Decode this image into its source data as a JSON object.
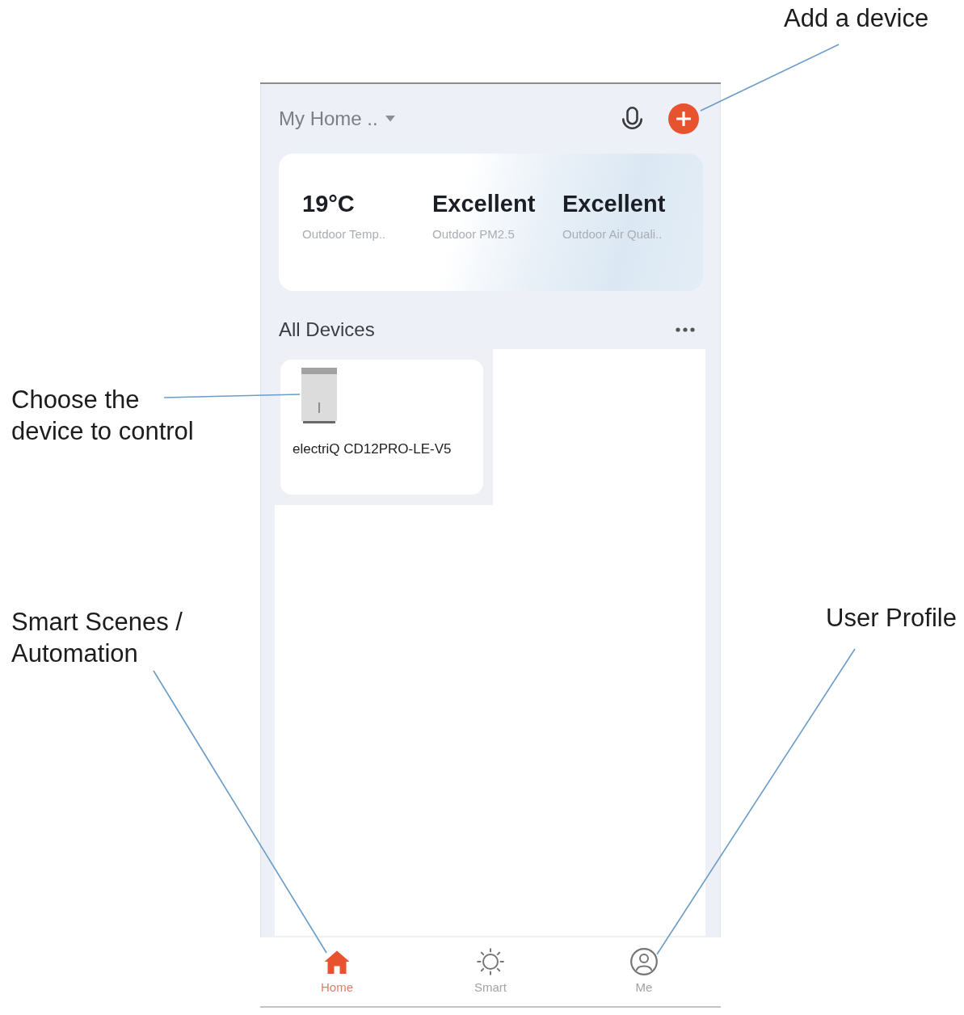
{
  "callouts": [
    {
      "text": "Add a device"
    },
    {
      "text": "Choose the device to control"
    },
    {
      "text": "Smart Scenes / Automation"
    },
    {
      "text": "User Profile"
    }
  ],
  "app": {
    "home_selector": {
      "label": "My Home .."
    },
    "weather": [
      {
        "value": "19°C",
        "label": "Outdoor Temp.."
      },
      {
        "value": "Excellent",
        "label": "Outdoor PM2.5"
      },
      {
        "value": "Excellent",
        "label": "Outdoor Air Quali.."
      }
    ],
    "section_title": "All Devices",
    "devices": [
      {
        "name": "electriQ CD12PRO-LE-V5"
      }
    ],
    "nav": [
      {
        "kind": "home",
        "label": "Home",
        "selected": true
      },
      {
        "kind": "scene",
        "label": "Smart",
        "selected": false
      },
      {
        "kind": "profile",
        "label": "Me",
        "selected": false
      }
    ]
  }
}
